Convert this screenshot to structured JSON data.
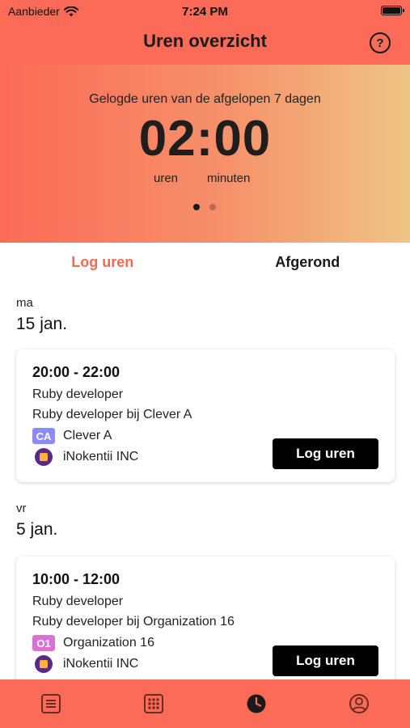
{
  "status_bar": {
    "carrier": "Aanbieder",
    "time": "7:24 PM"
  },
  "header": {
    "title": "Uren overzicht",
    "help_label": "?",
    "subtitle": "Gelogde uren van de afgelopen 7 dagen",
    "total_time": "02:00",
    "unit_hours": "uren",
    "unit_minutes": "minuten"
  },
  "tabs": [
    {
      "label": "Log uren"
    },
    {
      "label": "Afgerond"
    }
  ],
  "days": [
    {
      "day_name": "ma",
      "date": "15  jan.",
      "entry": {
        "time": "20:00 - 22:00",
        "role": "Ruby developer",
        "description": "Ruby developer bij Clever A",
        "org_badge": "CA",
        "org_badge_color": "#8b8cf5",
        "org_name": "Clever A",
        "company": "iNokentii INC",
        "button": "Log uren"
      }
    },
    {
      "day_name": "vr",
      "date": "5  jan.",
      "entry": {
        "time": "10:00 - 12:00",
        "role": "Ruby developer",
        "description": "Ruby developer bij Organization 16",
        "org_badge": "O1",
        "org_badge_color": "#d873d4",
        "org_name": "Organization 16",
        "company": "iNokentii INC",
        "button": "Log uren"
      }
    }
  ],
  "tabbar": {
    "icons": [
      "list-icon",
      "grid-icon",
      "clock-icon",
      "profile-icon"
    ]
  },
  "colors": {
    "accent": "#fb6b57",
    "active_tab": "#f26a55"
  }
}
